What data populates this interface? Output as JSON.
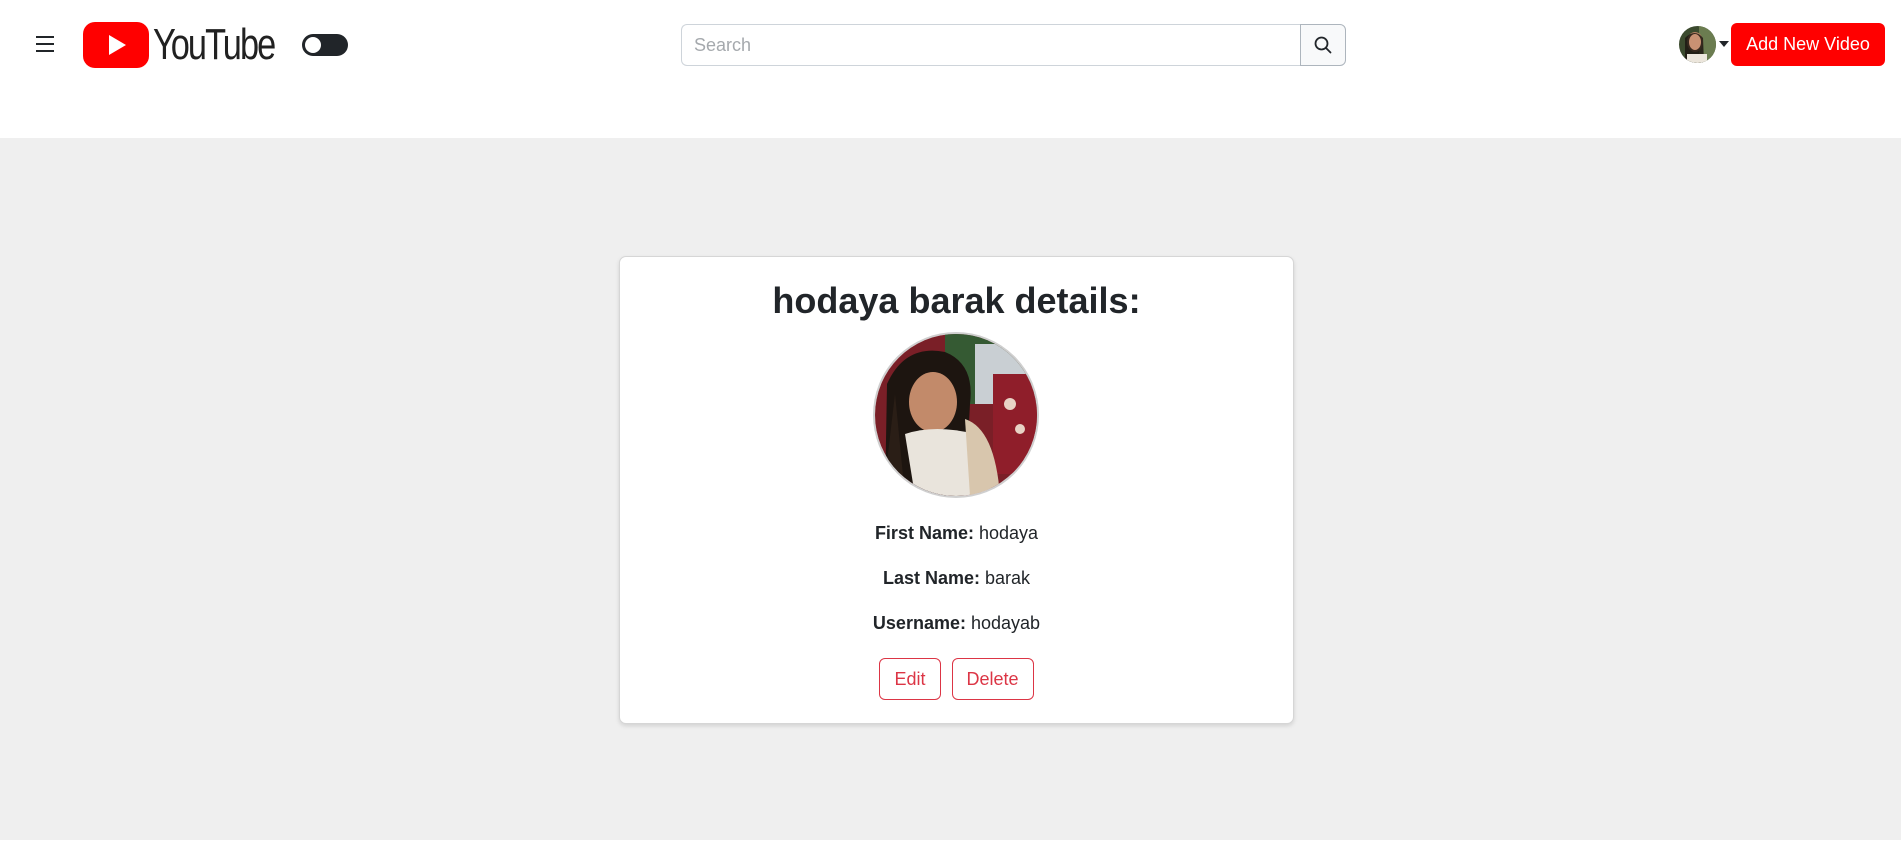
{
  "header": {
    "menu_icon": "hamburger-menu-icon",
    "logo_text": "YouTube",
    "brand_color": "#ff0000",
    "theme_toggle_icon": "toggle-switch-icon",
    "search": {
      "placeholder": "Search",
      "value": "",
      "button_icon": "search-icon"
    },
    "user_avatar_icon": "user-avatar",
    "dropdown_icon": "caret-down-icon",
    "add_video_label": "Add New Video"
  },
  "profile": {
    "title": "hodaya barak details:",
    "picture_icon": "profile-photo",
    "fields": [
      {
        "label": "First Name:",
        "value": "hodaya"
      },
      {
        "label": "Last Name:",
        "value": "barak"
      },
      {
        "label": "Username:",
        "value": "hodayab"
      }
    ],
    "edit_label": "Edit",
    "delete_label": "Delete",
    "action_color": "#dc3545"
  }
}
